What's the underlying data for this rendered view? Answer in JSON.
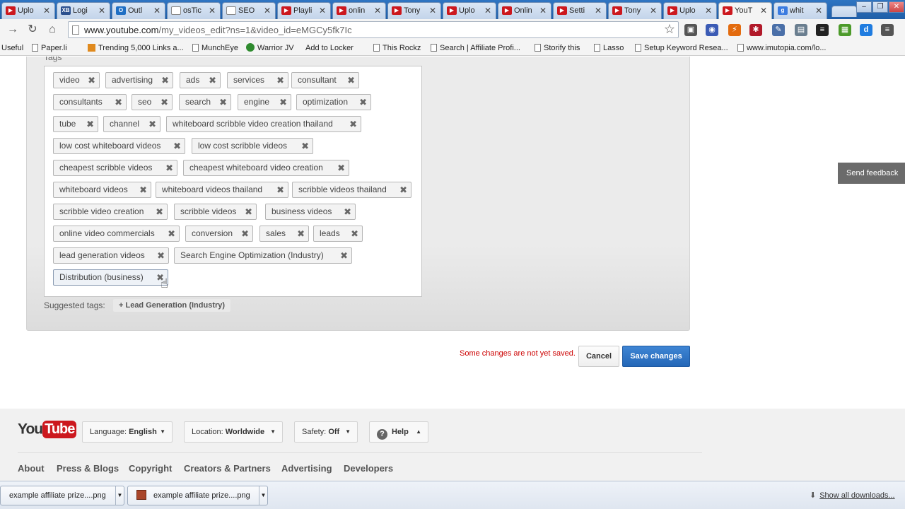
{
  "tabs": [
    {
      "title": "Uplo",
      "icon": "youtube-icon",
      "color": "#cc181e",
      "glyph": "▶"
    },
    {
      "title": "Logi",
      "icon": "xb-icon",
      "color": "#2a4f8e",
      "glyph": "XB"
    },
    {
      "title": "Outl",
      "icon": "outlook-icon",
      "color": "#1f6fc4",
      "glyph": "O"
    },
    {
      "title": "osTic",
      "icon": "page-icon",
      "color": "#ffffff",
      "glyph": ""
    },
    {
      "title": "SEO",
      "icon": "page-icon",
      "color": "#ffffff",
      "glyph": ""
    },
    {
      "title": "Playli",
      "icon": "youtube-icon",
      "color": "#cc181e",
      "glyph": "▶"
    },
    {
      "title": "onlin",
      "icon": "youtube-icon",
      "color": "#cc181e",
      "glyph": "▶"
    },
    {
      "title": "Tony",
      "icon": "youtube-icon",
      "color": "#cc181e",
      "glyph": "▶"
    },
    {
      "title": "Uplo",
      "icon": "youtube-icon",
      "color": "#cc181e",
      "glyph": "▶"
    },
    {
      "title": "Onlin",
      "icon": "youtube-icon",
      "color": "#cc181e",
      "glyph": "▶"
    },
    {
      "title": "Setti",
      "icon": "youtube-icon",
      "color": "#cc181e",
      "glyph": "▶"
    },
    {
      "title": "Tony",
      "icon": "youtube-icon",
      "color": "#cc181e",
      "glyph": "▶"
    },
    {
      "title": "Uplo",
      "icon": "youtube-icon",
      "color": "#cc181e",
      "glyph": "▶"
    },
    {
      "title": "YouT",
      "icon": "youtube-icon",
      "color": "#cc181e",
      "glyph": "▶",
      "active": true
    },
    {
      "title": "whit",
      "icon": "google-icon",
      "color": "#3a7be0",
      "glyph": "g"
    }
  ],
  "toolbar": {
    "back_glyph": "→",
    "reload_glyph": "↻",
    "home_glyph": "⌂",
    "url_host": "www.youtube.com",
    "url_path": "/my_videos_edit?ns=1&video_id=eMGCy5fk7Ic",
    "star_glyph": "☆",
    "extensions": [
      {
        "name": "badge-extension-icon",
        "color": "#555555",
        "glyph": "▣"
      },
      {
        "name": "chrome-extension-icon",
        "color": "#3b5bb5",
        "glyph": "◉"
      },
      {
        "name": "lightning-extension-icon",
        "color": "#e36b0f",
        "glyph": "⚡"
      },
      {
        "name": "lastpass-extension-icon",
        "color": "#b1192a",
        "glyph": "✱"
      },
      {
        "name": "pen-extension-icon",
        "color": "#4a6fa8",
        "glyph": "✎"
      },
      {
        "name": "screen-extension-icon",
        "color": "#6a7e8f",
        "glyph": "▤"
      },
      {
        "name": "buffer-extension-icon",
        "color": "#222222",
        "glyph": "≡"
      },
      {
        "name": "evernote-extension-icon",
        "color": "#4c9a2a",
        "glyph": "▦"
      },
      {
        "name": "d-extension-icon",
        "color": "#1f7ce0",
        "glyph": "d"
      },
      {
        "name": "menu-icon",
        "color": "#555555",
        "glyph": "≡"
      }
    ]
  },
  "bookmarks": [
    {
      "label": "Useful",
      "icon": "none"
    },
    {
      "label": "Paper.li",
      "icon": "page"
    },
    {
      "label": "Trending 5,000 Links a...",
      "icon": "orange"
    },
    {
      "label": "MunchEye",
      "icon": "page"
    },
    {
      "label": "Warrior JV",
      "icon": "round"
    },
    {
      "label": "Add to Locker",
      "icon": "none"
    },
    {
      "label": "This Rockz",
      "icon": "page"
    },
    {
      "label": "Search | Affiliate Profi...",
      "icon": "page"
    },
    {
      "label": "Storify this",
      "icon": "page"
    },
    {
      "label": "Lasso",
      "icon": "page"
    },
    {
      "label": "Setup Keyword Resea...",
      "icon": "page"
    },
    {
      "label": "www.imutopia.com/lo...",
      "icon": "page"
    }
  ],
  "tags_section": {
    "label": "Tags",
    "tags": [
      "video",
      "advertising",
      "ads",
      "services",
      "consultant",
      "consultants",
      "seo",
      "search",
      "engine",
      "optimization",
      "tube",
      "channel",
      "whiteboard scribble video creation thailand",
      "low cost whiteboard videos",
      "low cost scribble videos",
      "cheapest scribble videos",
      "cheapest whiteboard video creation",
      "whiteboard videos",
      "whiteboard videos thailand",
      "scribble videos thailand",
      "scribble video creation",
      "scribble videos",
      "business videos",
      "online video commercials",
      "conversion",
      "sales",
      "leads",
      "lead generation videos",
      "Search Engine Optimization (Industry)",
      "Distribution (business)"
    ],
    "remove_glyph": "✖",
    "suggested_label": "Suggested tags:",
    "suggested": [
      "+ Lead Generation (Industry)"
    ]
  },
  "actions": {
    "unsaved_message": "Some changes are not yet saved.",
    "cancel_label": "Cancel",
    "save_label": "Save changes"
  },
  "footer": {
    "logo_you": "You",
    "logo_tube": "Tube",
    "language_label": "Language:",
    "language_value": "English",
    "location_label": "Location:",
    "location_value": "Worldwide",
    "safety_label": "Safety:",
    "safety_value": "Off",
    "help_label": "Help",
    "links": [
      "About",
      "Press & Blogs",
      "Copyright",
      "Creators & Partners",
      "Advertising",
      "Developers"
    ],
    "send_feedback": "Send feedback"
  },
  "downloads": {
    "items": [
      "example affiliate prize....png",
      "example affiliate prize....png"
    ],
    "show_all": "Show all downloads..."
  }
}
